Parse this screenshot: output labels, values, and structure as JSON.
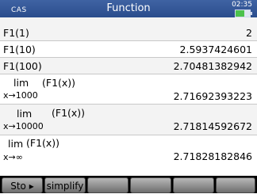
{
  "header": {
    "mode": "CAS",
    "title": "Function",
    "time": "02:35"
  },
  "history": [
    {
      "expr": "F1(1)",
      "result": "2"
    },
    {
      "expr": "F1(10)",
      "result": "2.5937424601"
    },
    {
      "expr": "F1(100)",
      "result": "2.70481382942"
    },
    {
      "lim": "lim",
      "func": "(F1(x))",
      "sub": "x→1000",
      "result": "2.71692393223"
    },
    {
      "lim": "lim",
      "func": "(F1(x))",
      "sub": "x→10000",
      "result": "2.71814592672"
    },
    {
      "lim": "lim",
      "func": "(F1(x))",
      "sub": "x→∞",
      "result": "2.71828182846"
    }
  ],
  "menu": {
    "sto": "Sto ▸",
    "simplify": "simplify"
  }
}
